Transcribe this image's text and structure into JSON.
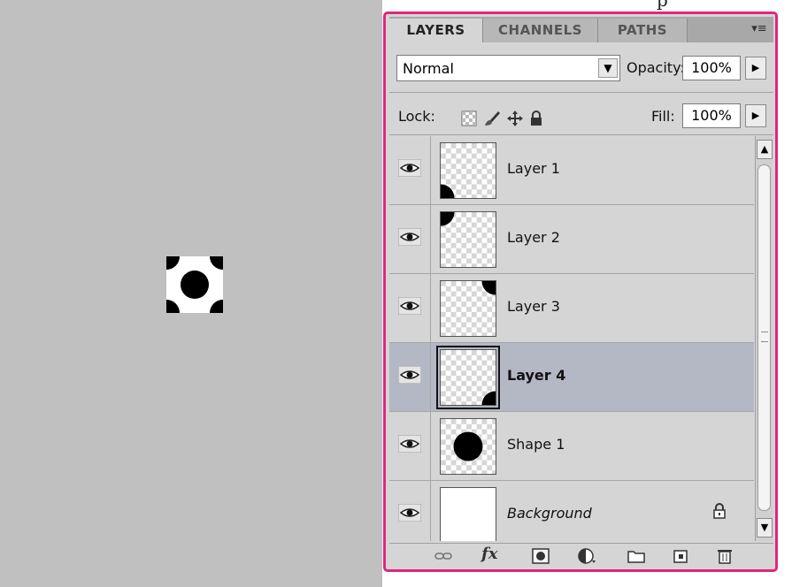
{
  "page": {
    "cut_text": "p"
  },
  "panel": {
    "tabs": [
      {
        "label": "LAYERS"
      },
      {
        "label": "CHANNELS"
      },
      {
        "label": "PATHS"
      }
    ],
    "menu_icon": "panel-menu-icon",
    "blend_mode": "Normal",
    "opacity_label": "Opacity:",
    "opacity_value": "100%",
    "lock_label": "Lock:",
    "fill_label": "Fill:",
    "fill_value": "100%",
    "layers": [
      {
        "name": "Layer 1",
        "visible": true
      },
      {
        "name": "Layer 2",
        "visible": true
      },
      {
        "name": "Layer 3",
        "visible": true
      },
      {
        "name": "Layer 4",
        "visible": true,
        "selected": true
      },
      {
        "name": "Shape 1",
        "visible": true
      },
      {
        "name": "Background",
        "visible": true,
        "locked": true
      }
    ],
    "bottom_icons": [
      "link-icon",
      "fx-icon",
      "mask-icon",
      "adjustment-icon",
      "folder-icon",
      "new-layer-icon",
      "trash-icon"
    ],
    "fx_label": "fx"
  },
  "colors": {
    "accent_border": "#e0267c",
    "selected_row": "#b4b7c4",
    "canvas": "#c0c0c0"
  }
}
